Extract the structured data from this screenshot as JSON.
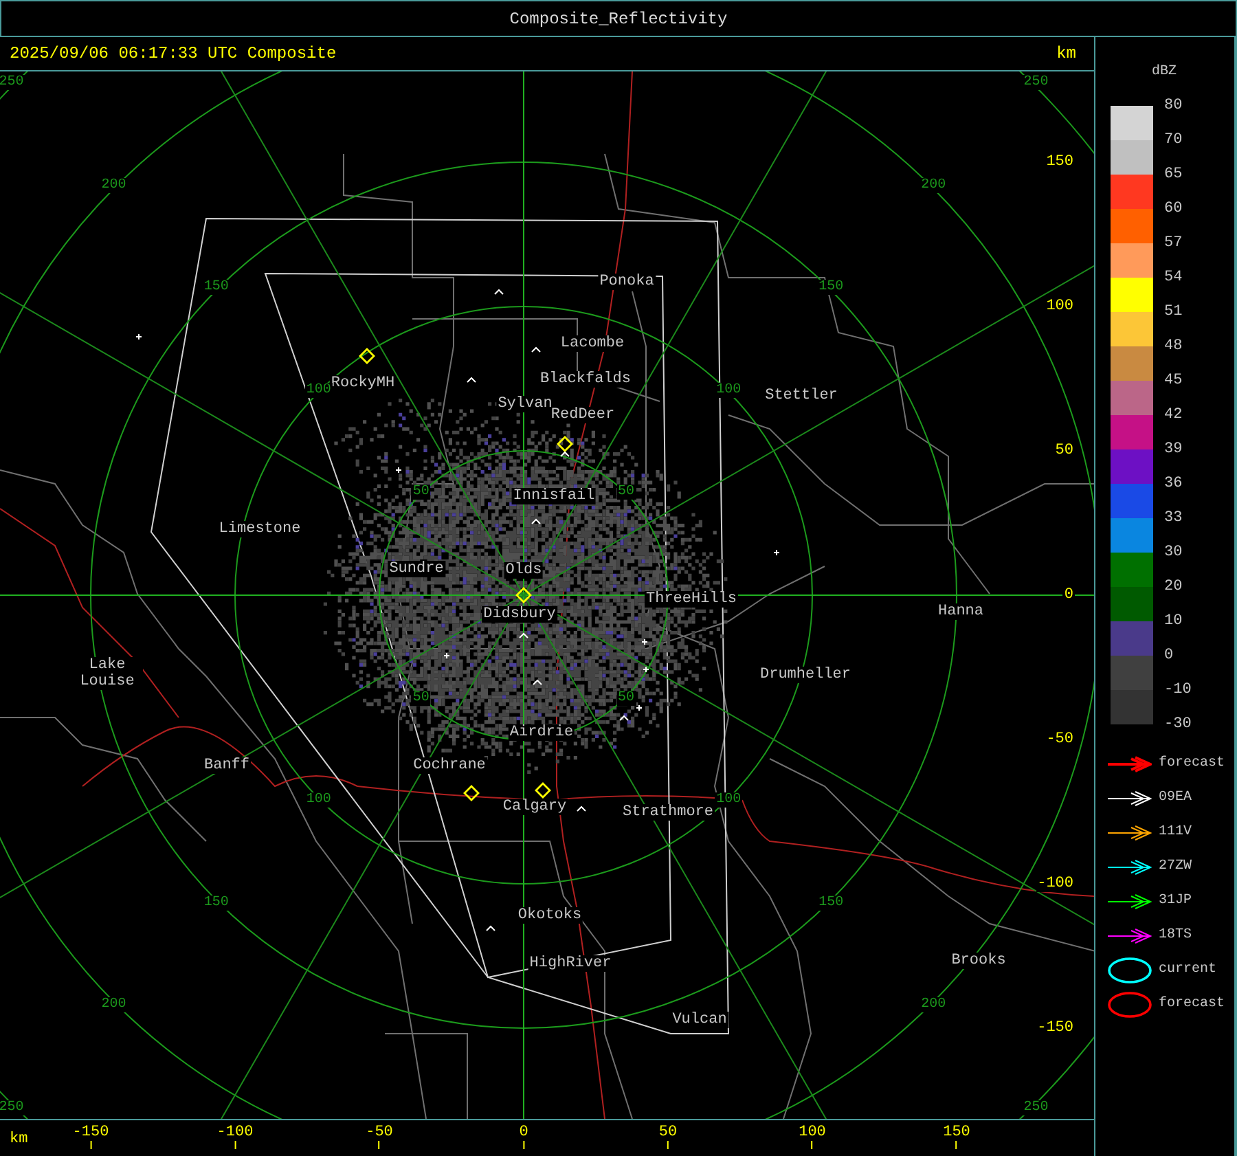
{
  "window": {
    "title": "Composite_Reflectivity"
  },
  "header": {
    "timestamp": "2025/09/06 06:17:33 UTC Composite",
    "units": "km"
  },
  "map": {
    "cities": [
      {
        "name": "Ponoka"
      },
      {
        "name": "Lacombe"
      },
      {
        "name": "Blackfalds"
      },
      {
        "name": "Sylvan"
      },
      {
        "name": "RedDeer"
      },
      {
        "name": "RockyMH"
      },
      {
        "name": "Stettler"
      },
      {
        "name": "Innisfail"
      },
      {
        "name": "Limestone"
      },
      {
        "name": "Sundre"
      },
      {
        "name": "Olds"
      },
      {
        "name": "Didsbury"
      },
      {
        "name": "ThreeHills"
      },
      {
        "name": "Hanna"
      },
      {
        "name": "Lake Louise"
      },
      {
        "name": "Drumheller"
      },
      {
        "name": "Airdrie"
      },
      {
        "name": "Banff"
      },
      {
        "name": "Cochrane"
      },
      {
        "name": "Calgary"
      },
      {
        "name": "Strathmore"
      },
      {
        "name": "Okotoks"
      },
      {
        "name": "Brooks"
      },
      {
        "name": "HighRiver"
      },
      {
        "name": "Vulcan"
      }
    ],
    "range_rings": [
      {
        "labels": [
          "50",
          "50",
          "50",
          "50"
        ]
      },
      {
        "labels": [
          "100",
          "100",
          "100",
          "100"
        ]
      },
      {
        "labels": [
          "150",
          "150",
          "150",
          "150"
        ]
      },
      {
        "labels": [
          "200",
          "200",
          "200",
          "200"
        ]
      },
      {
        "labels": [
          "250",
          "250",
          "250",
          "250"
        ]
      }
    ],
    "y_axis": {
      "ticks": [
        "150",
        "100",
        "50",
        "0",
        "-50",
        "-100",
        "-150"
      ]
    },
    "x_axis": {
      "units": "km",
      "ticks": [
        "-150",
        "-100",
        "-50",
        "0",
        "50",
        "100",
        "150"
      ]
    }
  },
  "legend": {
    "title": "dBZ",
    "scale": {
      "labels": [
        "80",
        "70",
        "65",
        "60",
        "57",
        "54",
        "51",
        "48",
        "45",
        "42",
        "39",
        "36",
        "33",
        "30",
        "20",
        "10",
        "0",
        "-10",
        "-30"
      ],
      "bins": [
        {
          "color": "#d4d4d4"
        },
        {
          "color": "#c0c0c0"
        },
        {
          "color": "#ff3820"
        },
        {
          "color": "#ff6000"
        },
        {
          "color": "#ff9a5a"
        },
        {
          "color": "#ffff00"
        },
        {
          "color": "#fcc637"
        },
        {
          "color": "#c98a41"
        },
        {
          "color": "#bb6688"
        },
        {
          "color": "#c51186"
        },
        {
          "color": "#6d10c4"
        },
        {
          "color": "#1a4ae6"
        },
        {
          "color": "#0a86e0"
        },
        {
          "color": "#007000"
        },
        {
          "color": "#005a00"
        },
        {
          "color": "#4a3a8a"
        },
        {
          "color": "#404040"
        },
        {
          "color": "#333333"
        }
      ]
    },
    "tracks": [
      {
        "kind": "arrow",
        "label": "forecast",
        "color": "#ff0000"
      },
      {
        "kind": "arrow",
        "label": "09EA",
        "color": "#ffffff"
      },
      {
        "kind": "arrow",
        "label": "111V",
        "color": "#ffa500"
      },
      {
        "kind": "arrow",
        "label": "27ZW",
        "color": "#00ffff"
      },
      {
        "kind": "arrow",
        "label": "31JP",
        "color": "#00ff00"
      },
      {
        "kind": "arrow",
        "label": "18TS",
        "color": "#ff00ff"
      },
      {
        "kind": "ellipse",
        "label": "current",
        "color": "#00ffff"
      },
      {
        "kind": "ellipse",
        "label": "forecast",
        "color": "#ff0000"
      }
    ]
  }
}
